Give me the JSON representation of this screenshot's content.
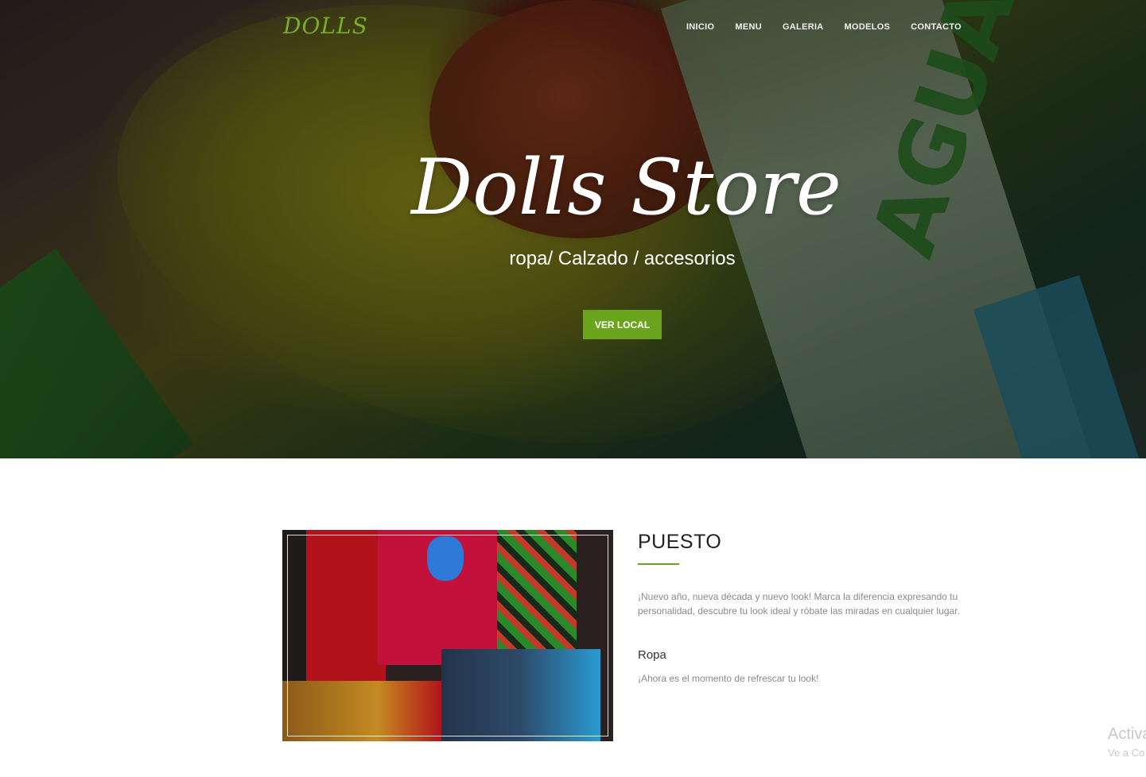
{
  "brand": {
    "name": "DOLLS"
  },
  "nav": {
    "items": [
      {
        "label": "INICIO"
      },
      {
        "label": "MENU"
      },
      {
        "label": "GALERIA"
      },
      {
        "label": "MODELOS"
      },
      {
        "label": "CONTACTO"
      }
    ]
  },
  "hero": {
    "title": "Dolls Store",
    "subtitle": "ropa/ Calzado / accesorios",
    "button_label": "VER LOCAL",
    "background_label": "AGUACATE Y"
  },
  "about": {
    "title": "PUESTO",
    "text": "¡Nuevo año, nueva década y nuevo look! Marca la diferencia expresando tu personalidad, descubre tu look ideal y róbate las miradas en cualquier lugar.",
    "sub_title": "Ropa",
    "sub_text": "¡Ahora es el momento de refrescar tu look!"
  },
  "watermark": {
    "line1": "Activa",
    "line2": "Ve a Co"
  },
  "colors": {
    "accent": "#6aa41c",
    "brand": "#7aac2c"
  }
}
